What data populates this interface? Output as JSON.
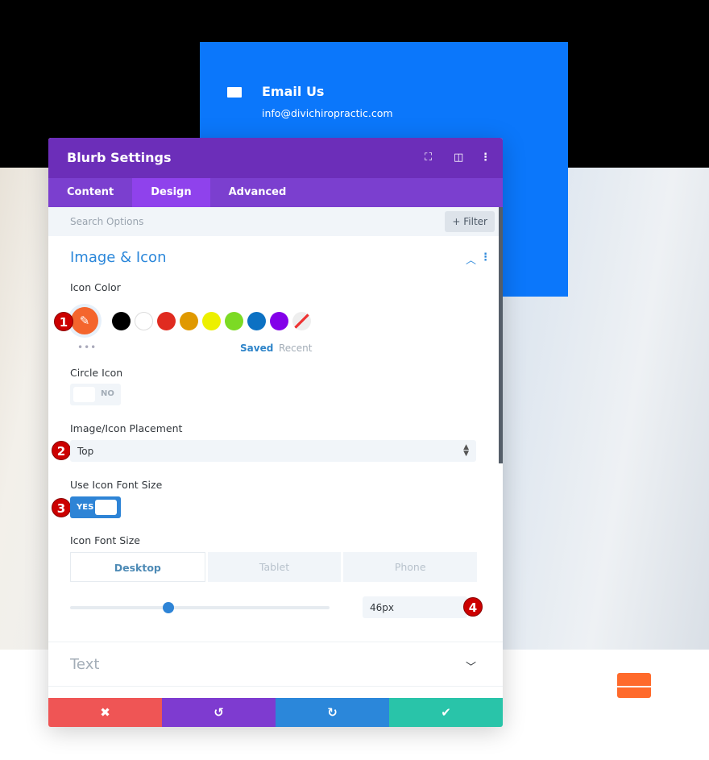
{
  "background": {
    "blurb": {
      "title": "Email Us",
      "email": "info@divichiropractic.com",
      "icon": "envelope-icon"
    },
    "accent_color": "#0b77fb",
    "orange_icon": "envelope-icon"
  },
  "panel": {
    "title": "Blurb Settings",
    "header_icons": [
      "fullscreen-icon",
      "split-view-icon",
      "more-vertical-icon"
    ],
    "tabs": [
      {
        "label": "Content"
      },
      {
        "label": "Design",
        "active": true
      },
      {
        "label": "Advanced"
      }
    ],
    "search_placeholder": "Search Options",
    "filter_label": "+ Filter",
    "section": {
      "title": "Image & Icon",
      "icon_color": {
        "label": "Icon Color",
        "current": "#f4652d",
        "swatches": [
          "#000000",
          "#ffffff",
          "#e02b20",
          "#e09900",
          "#edf000",
          "#7cda24",
          "#0c71c3",
          "#8300e9",
          "none"
        ],
        "more": "•••",
        "saved": "Saved",
        "recent": "Recent"
      },
      "circle_icon": {
        "label": "Circle Icon",
        "value": "NO"
      },
      "placement": {
        "label": "Image/Icon Placement",
        "value": "Top"
      },
      "use_font_size": {
        "label": "Use Icon Font Size",
        "value": "YES"
      },
      "font_size": {
        "label": "Icon Font Size",
        "devices": [
          "Desktop",
          "Tablet",
          "Phone"
        ],
        "active_device": "Desktop",
        "value": "46px",
        "slider_percent": 38
      }
    },
    "badges": [
      "1",
      "2",
      "3",
      "4"
    ],
    "text_section": {
      "title": "Text"
    },
    "footer": {
      "cancel": "✖",
      "undo": "↺",
      "redo": "↻",
      "save": "✔"
    },
    "colors": {
      "header": "#6c2eb9",
      "tabs": "#7b3fcf",
      "cancel": "#ef5555",
      "undo": "#7e3bd0",
      "redo": "#2b87da",
      "save": "#29c4a9"
    }
  }
}
